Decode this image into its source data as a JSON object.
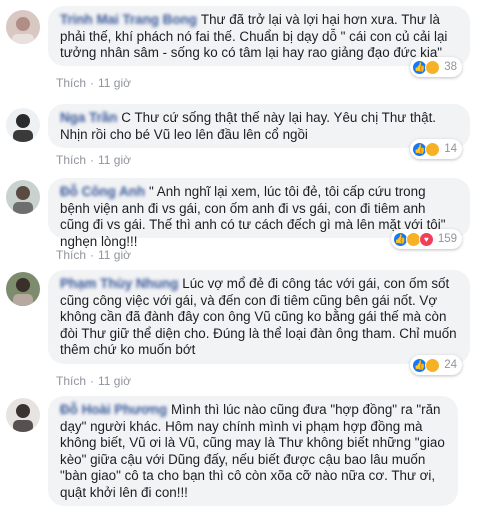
{
  "comments": [
    {
      "author": "Trinh Mai Trang Bong",
      "text": "Thư đã trở lại và lợi hại hơn xưa. Thư là phải thế, khí phách nó fai thế. Chuẩn bị dạy dỗ \" cái con củ cải lại tưởng nhân sâm - sống ko có tâm lại hay rao giảng đạo đức kia\"",
      "reactions": [
        "like",
        "haha"
      ],
      "reaction_count": "38",
      "like_label": "Thích",
      "time": "11 giờ"
    },
    {
      "author": "Nga Trần",
      "text": "C Thư cứ sống thật thế này lại hay. Yêu chị Thư thật. Nhịn rồi cho bé Vũ leo lên đầu lên cổ ngồi",
      "reactions": [
        "like",
        "haha"
      ],
      "reaction_count": "14",
      "like_label": "Thích",
      "time": "11 giờ"
    },
    {
      "author": "Đỗ Công Anh",
      "text": "\" Anh nghĩ lại xem, lúc tôi đẻ, tôi cấp cứu trong bệnh viện anh đi vs gái, con ốm anh đi vs gái, con đi tiêm anh cũng đi vs gái. Thế thì anh có tư cách đếch gì mà lên mặt với tôi\" nghẹn lòng!!!",
      "reactions": [
        "like",
        "haha",
        "heart"
      ],
      "reaction_count": "159",
      "like_label": "Thích",
      "time": "11 giờ"
    },
    {
      "author": "Phạm Thùy Nhung",
      "text": "Lúc vợ mổ đẻ đi công tác với gái, con ốm sốt cũng công việc với gái, và đến con đi tiêm cũng bên gái nốt. Vợ không cần đã đành đây con ông Vũ cũng ko bằng gái thế mà còn đòi Thư giữ thể diện cho. Đúng là thể loại đàn ông tham. Chỉ muốn thêm chứ ko muốn bớt",
      "reactions": [
        "like",
        "sad"
      ],
      "reaction_count": "24",
      "like_label": "Thích",
      "time": "11 giờ"
    },
    {
      "author": "Đỗ Hoài Phương",
      "text": "Mình thì lúc nào cũng đưa \"hợp đồng\" ra \"răn dạy\" người khác. Hôm nay chính mình vi phạm hợp đồng mà không biết, Vũ ơi là Vũ, cũng may là Thư không biết những \"giao kèo\" giữa cậu với Dũng đấy, nếu biết được cậu bao lâu muốn \"bàn giao\" cô ta cho bạn thì cô còn xõa cỡ nào nữa cơ. Thư ơi, quật khởi lên đi con!!!",
      "reactions": [],
      "reaction_count": "",
      "like_label": "",
      "time": ""
    }
  ],
  "colors": {
    "author": "#385898",
    "bubble": "#f2f3f5",
    "meta": "#90949c"
  }
}
